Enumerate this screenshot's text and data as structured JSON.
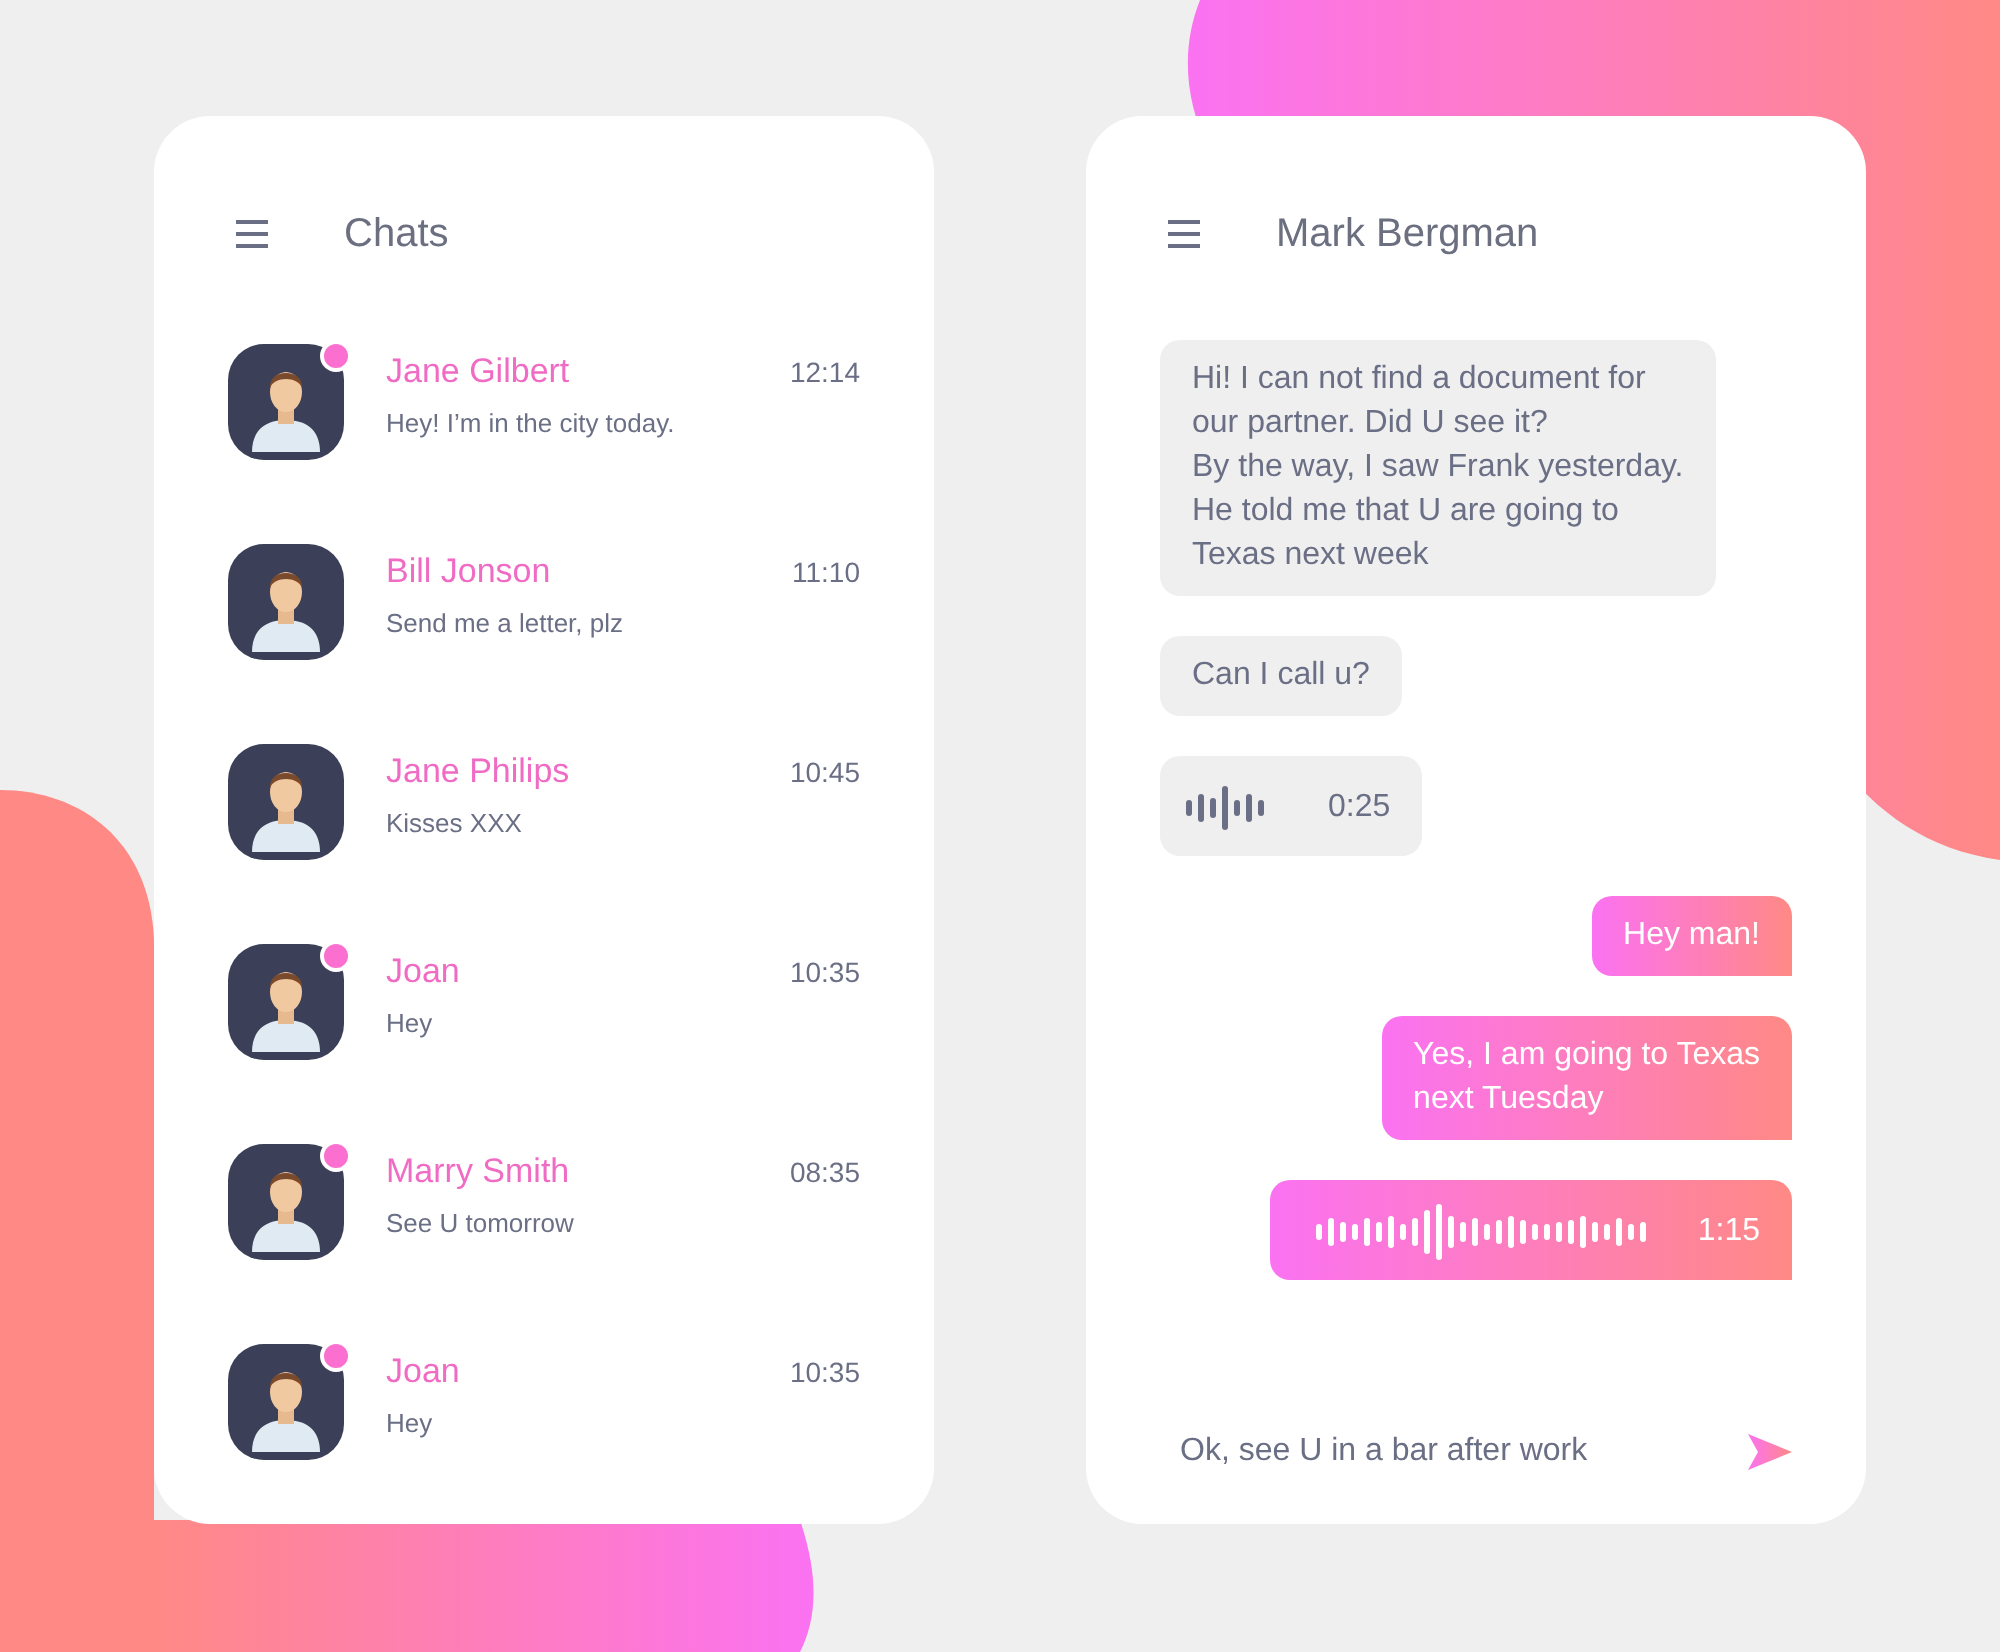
{
  "chats_panel": {
    "title": "Chats",
    "chats": [
      {
        "name": "Jane Gilbert",
        "time": "12:14",
        "preview": "Hey! I’m in the city today.",
        "unread": true
      },
      {
        "name": "Bill Jonson",
        "time": "11:10",
        "preview": "Send me a letter, plz",
        "unread": false
      },
      {
        "name": "Jane Philips",
        "time": "10:45",
        "preview": "Kisses  XXX",
        "unread": false
      },
      {
        "name": "Joan",
        "time": "10:35",
        "preview": "Hey",
        "unread": true
      },
      {
        "name": "Marry Smith",
        "time": "08:35",
        "preview": "See U tomorrow",
        "unread": true
      },
      {
        "name": "Joan",
        "time": "10:35",
        "preview": "Hey",
        "unread": true
      }
    ]
  },
  "conversation": {
    "title": "Mark Bergman",
    "messages": [
      {
        "kind": "text",
        "outgoing": false,
        "lines": [
          "Hi! I can not find a document for",
          "our partner. Did U see it?",
          "By the way, I saw Frank yesterday.",
          "He told me that U are going to",
          "Texas next week"
        ]
      },
      {
        "kind": "text",
        "outgoing": false,
        "lines": [
          "Can I call u?"
        ]
      },
      {
        "kind": "voice",
        "outgoing": false,
        "duration": "0:25"
      },
      {
        "kind": "text",
        "outgoing": true,
        "lines": [
          "Hey man!"
        ]
      },
      {
        "kind": "text",
        "outgoing": true,
        "lines": [
          "Yes, I am going to Texas",
          "next Tuesday"
        ]
      },
      {
        "kind": "voice",
        "outgoing": true,
        "duration": "1:15"
      }
    ],
    "composer": {
      "value": "Ok, see U in a bar after work"
    }
  }
}
